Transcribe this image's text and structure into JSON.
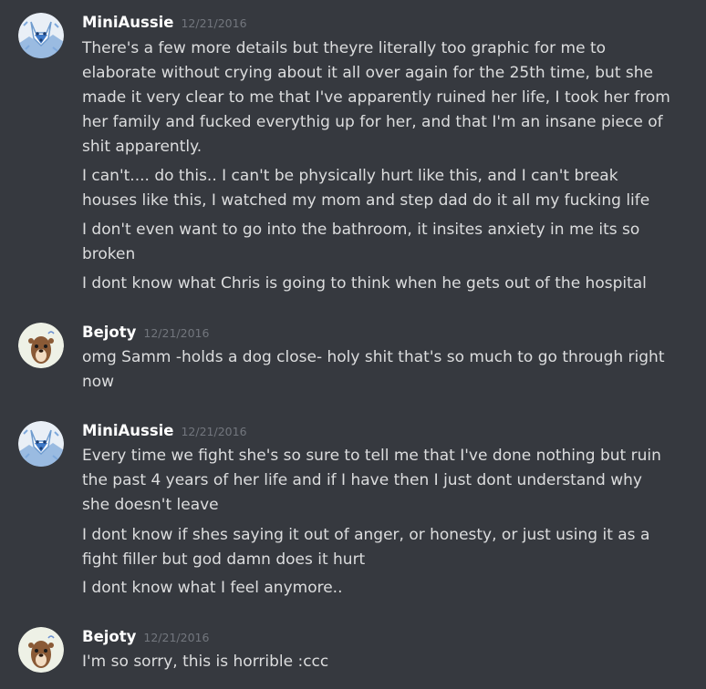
{
  "colors": {
    "background": "#36393f",
    "username": "#ffffff",
    "timestamp": "#72767d",
    "message_text": "#dcddde"
  },
  "groups": [
    {
      "author": "MiniAussie",
      "avatar_icon": "husky-dog-avatar-icon",
      "timestamp": "12/21/2016",
      "messages": [
        "There's a few more details but theyre literally too graphic for me to\nelaborate without crying about it all over again for the 25th time, but she\nmade it very clear to me that I've apparently ruined her life, I took her from\nher family and fucked everythig up for her, and that I'm an insane piece of\nshit apparently.",
        "I can't.... do this.. I can't be physically hurt like this, and I can't break\nhouses like this, I watched my mom and step dad do it all my fucking life",
        "I don't even want to go into the bathroom, it insites anxiety in me its so\nbroken",
        "I dont know what Chris is going to think when he gets out of the hospital"
      ]
    },
    {
      "author": "Bejoty",
      "avatar_icon": "otter-avatar-icon",
      "timestamp": "12/21/2016",
      "messages": [
        "omg Samm -holds a dog close- holy shit that's so much to go through right\nnow"
      ]
    },
    {
      "author": "MiniAussie",
      "avatar_icon": "husky-dog-avatar-icon",
      "timestamp": "12/21/2016",
      "messages": [
        "Every time we fight she's so sure to tell me that I've done nothing but ruin\nthe past 4 years of her life and if I have then I just dont understand why\nshe doesn't leave",
        "I dont know if shes saying it out of anger, or honesty, or just using it as a\nfight filler but god damn does it hurt",
        "I dont know what I feel anymore.."
      ]
    },
    {
      "author": "Bejoty",
      "avatar_icon": "otter-avatar-icon",
      "timestamp": "12/21/2016",
      "messages": [
        "I'm so sorry, this is horrible :ccc"
      ]
    }
  ]
}
